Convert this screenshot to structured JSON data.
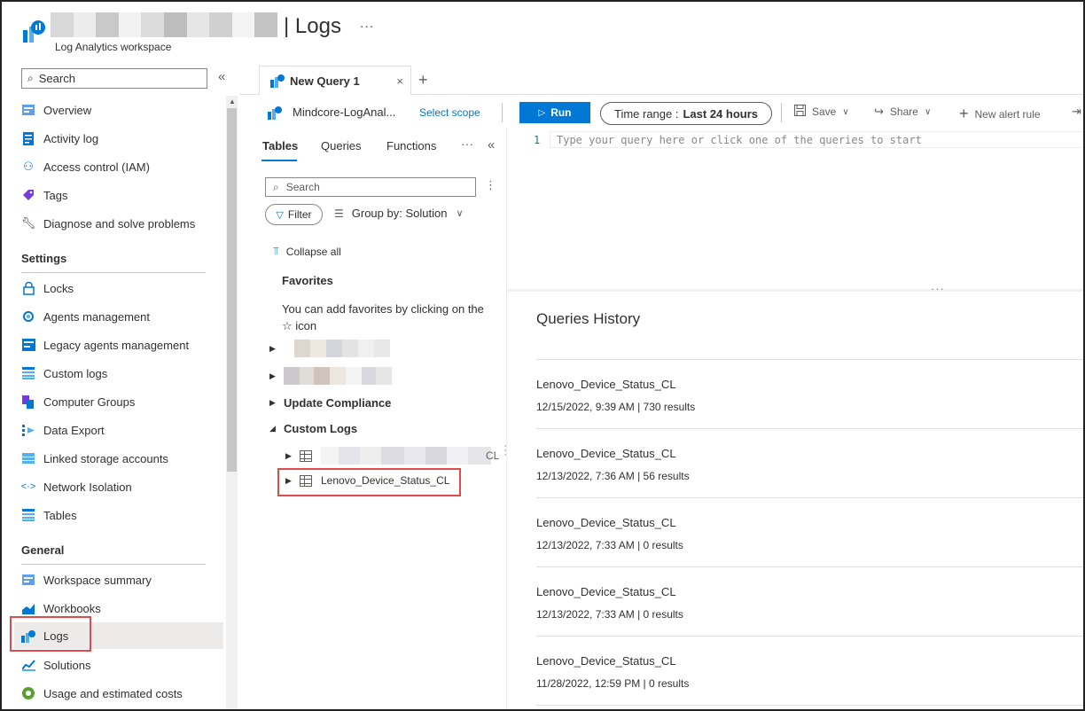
{
  "header": {
    "title": "| Logs",
    "subtitle": "Log Analytics workspace",
    "more": "..."
  },
  "sidebar": {
    "search_placeholder": "Search",
    "collapse": "«",
    "items_top": [
      {
        "label": "Overview",
        "icon": "overview-icon"
      },
      {
        "label": "Activity log",
        "icon": "activity-log-icon"
      },
      {
        "label": "Access control (IAM)",
        "icon": "people-icon"
      },
      {
        "label": "Tags",
        "icon": "tag-icon"
      },
      {
        "label": "Diagnose and solve problems",
        "icon": "wrench-icon"
      }
    ],
    "settings_header": "Settings",
    "items_settings": [
      {
        "label": "Locks",
        "icon": "lock-icon"
      },
      {
        "label": "Agents management",
        "icon": "agents-icon"
      },
      {
        "label": "Legacy agents management",
        "icon": "legacy-agents-icon"
      },
      {
        "label": "Custom logs",
        "icon": "list-icon"
      },
      {
        "label": "Computer Groups",
        "icon": "computer-groups-icon"
      },
      {
        "label": "Data Export",
        "icon": "data-export-icon"
      },
      {
        "label": "Linked storage accounts",
        "icon": "storage-icon"
      },
      {
        "label": "Network Isolation",
        "icon": "network-icon"
      },
      {
        "label": "Tables",
        "icon": "table-icon"
      }
    ],
    "general_header": "General",
    "items_general": [
      {
        "label": "Workspace summary",
        "icon": "summary-icon"
      },
      {
        "label": "Workbooks",
        "icon": "workbooks-icon"
      },
      {
        "label": "Logs",
        "icon": "logs-icon"
      },
      {
        "label": "Solutions",
        "icon": "solutions-icon"
      },
      {
        "label": "Usage and estimated costs",
        "icon": "usage-icon"
      }
    ]
  },
  "query_tabs": {
    "active_tab": "New Query 1",
    "close": "×",
    "add": "+"
  },
  "toolbar": {
    "scope_name": "Mindcore-LogAnal...",
    "select_scope": "Select scope",
    "run": "Run",
    "time_range_label": "Time range :",
    "time_range_value": "Last 24 hours",
    "save": "Save",
    "share": "Share",
    "new_alert_rule": "New alert rule"
  },
  "schema_pane": {
    "tabs": [
      "Tables",
      "Queries",
      "Functions"
    ],
    "more": "···",
    "collapse": "«",
    "search_placeholder": "Search",
    "filter": "Filter",
    "group_by": "Group by: Solution",
    "collapse_all": "Collapse all",
    "favorites_header": "Favorites",
    "favorites_text": "You can add favorites by clicking on the ☆ icon",
    "update_compliance": "Update Compliance",
    "custom_logs": "Custom Logs",
    "blurred_table_suffix": "CL",
    "highlighted_table": "Lenovo_Device_Status_CL"
  },
  "editor": {
    "line_number": "1",
    "placeholder": "Type your query here or click one of the queries to start"
  },
  "history": {
    "title": "Queries History",
    "items": [
      {
        "name": "Lenovo_Device_Status_CL",
        "meta": "12/15/2022, 9:39 AM | 730 results"
      },
      {
        "name": "Lenovo_Device_Status_CL",
        "meta": "12/13/2022, 7:36 AM | 56 results"
      },
      {
        "name": "Lenovo_Device_Status_CL",
        "meta": "12/13/2022, 7:33 AM | 0 results"
      },
      {
        "name": "Lenovo_Device_Status_CL",
        "meta": "12/13/2022, 7:33 AM | 0 results"
      },
      {
        "name": "Lenovo_Device_Status_CL",
        "meta": "11/28/2022, 12:59 PM | 0 results"
      }
    ]
  },
  "colors": {
    "accent": "#0078d4",
    "highlight": "#e04c4c",
    "selected_bg": "#edebe9"
  }
}
